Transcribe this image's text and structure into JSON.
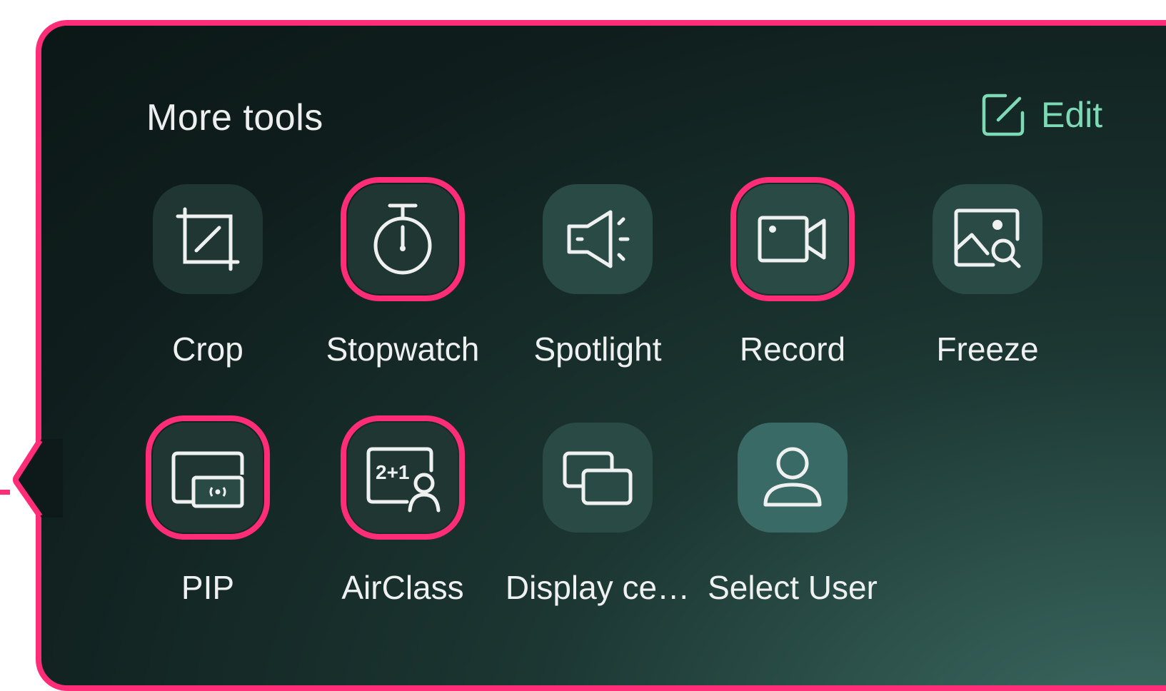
{
  "header": {
    "title": "More tools",
    "edit_label": "Edit"
  },
  "tools": [
    {
      "label": "Crop",
      "icon": "crop-icon",
      "highlighted": false
    },
    {
      "label": "Stopwatch",
      "icon": "stopwatch-icon",
      "highlighted": true
    },
    {
      "label": "Spotlight",
      "icon": "spotlight-icon",
      "highlighted": false
    },
    {
      "label": "Record",
      "icon": "record-icon",
      "highlighted": true
    },
    {
      "label": "Freeze",
      "icon": "freeze-icon",
      "highlighted": false
    },
    {
      "label": "PIP",
      "icon": "pip-icon",
      "highlighted": true
    },
    {
      "label": "AirClass",
      "icon": "airclass-icon",
      "highlighted": true
    },
    {
      "label": "Display ce…",
      "icon": "display-icon",
      "highlighted": false
    },
    {
      "label": "Select User",
      "icon": "user-icon",
      "highlighted": false
    }
  ],
  "colors": {
    "highlight": "#ff2d78",
    "accent": "#7dd9b6",
    "panel": "#0f1e1d"
  }
}
